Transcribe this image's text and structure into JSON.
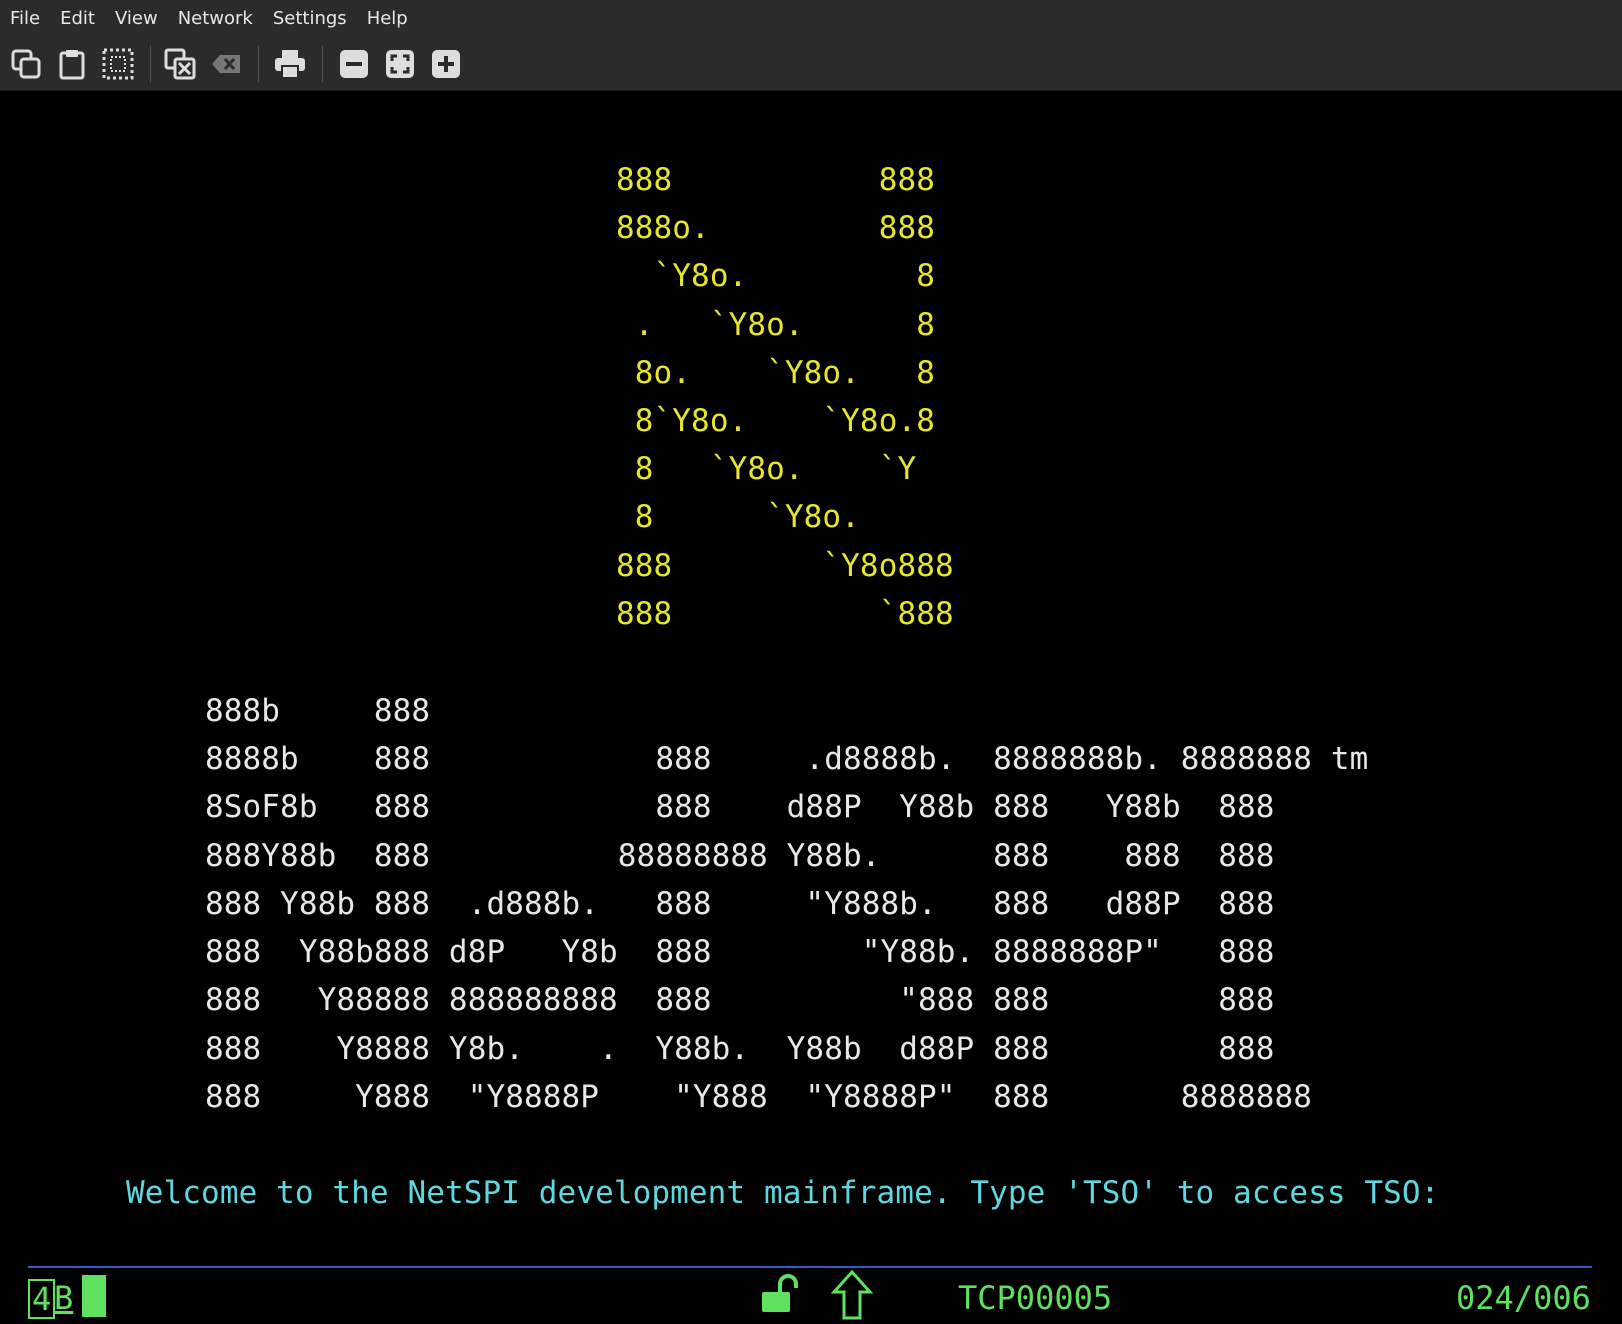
{
  "menu": [
    "File",
    "Edit",
    "View",
    "Network",
    "Settings",
    "Help"
  ],
  "logo_lines": [
    "888           888",
    "888o.         888",
    "  `Y8o.         8",
    " .   `Y8o.      8",
    " 8o.    `Y8o.   8",
    " 8`Y8o.    `Y8o.8",
    " 8   `Y8o.    `Y",
    " 8      `Y8o.",
    "888        `Y8o888",
    "888           `888"
  ],
  "banner_lines": [
    "888b     888",
    "8888b    888            888     .d8888b.  8888888b. 8888888 tm",
    "8SoF8b   888            888    d88P  Y88b 888   Y88b  888",
    "888Y88b  888          88888888 Y88b.      888    888  888",
    "888 Y88b 888  .d888b.   888     \"Y888b.   888   d88P  888",
    "888  Y88b888 d8P   Y8b  888        \"Y88b. 8888888P\"   888",
    "888   Y88888 888888888  888          \"888 888         888",
    "888    Y8888 Y8b.    .  Y88b.  Y88b  d88P 888         888",
    "888     Y888  \"Y8888P    \"Y888  \"Y8888P\"  888       8888888"
  ],
  "welcome": "Welcome to the NetSPI development mainframe. Type 'TSO' to access TSO:",
  "status": {
    "indicator_num": "4",
    "indicator_letter": "B",
    "connection": "TCP00005",
    "cursor_pos": "024/006"
  },
  "toolbar_icons": [
    "copy-icon",
    "paste-icon",
    "select-all-icon",
    "clear-icon",
    "erase-icon",
    "print-icon",
    "zoom-out-icon",
    "fit-icon",
    "zoom-in-icon"
  ],
  "colors": {
    "logo": "#e6e62e",
    "banner": "#e8e8e8",
    "welcome": "#5fd7e0",
    "status": "#5fe05f",
    "rule": "#3b5cc8"
  }
}
